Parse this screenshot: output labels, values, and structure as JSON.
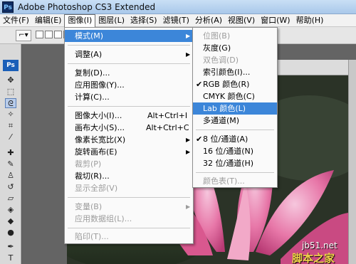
{
  "app": {
    "logo": "Ps",
    "title": "Adobe Photoshop CS3 Extended"
  },
  "menubar": [
    {
      "label": "文件(F)"
    },
    {
      "label": "编辑(E)"
    },
    {
      "label": "图像(I)"
    },
    {
      "label": "图层(L)"
    },
    {
      "label": "选择(S)"
    },
    {
      "label": "滤镜(T)"
    },
    {
      "label": "分析(A)"
    },
    {
      "label": "视图(V)"
    },
    {
      "label": "窗口(W)"
    },
    {
      "label": "帮助(H)"
    }
  ],
  "toolbox": {
    "badge": "Ps"
  },
  "image_menu": {
    "items": [
      {
        "label": "模式(M)",
        "submenu": true,
        "highlighted": true
      },
      {
        "label": "调整(A)",
        "submenu": true
      },
      {
        "label": "复制(D)..."
      },
      {
        "label": "应用图像(Y)..."
      },
      {
        "label": "计算(C)..."
      },
      {
        "label": "图像大小(I)...",
        "shortcut": "Alt+Ctrl+I"
      },
      {
        "label": "画布大小(S)...",
        "shortcut": "Alt+Ctrl+C"
      },
      {
        "label": "像素长宽比(X)",
        "submenu": true
      },
      {
        "label": "旋转画布(E)",
        "submenu": true
      },
      {
        "label": "裁剪(P)",
        "disabled": true
      },
      {
        "label": "裁切(R)..."
      },
      {
        "label": "显示全部(V)",
        "disabled": true
      },
      {
        "label": "变量(B)",
        "submenu": true,
        "disabled": true
      },
      {
        "label": "应用数据组(L)...",
        "disabled": true
      },
      {
        "label": "陷印(T)...",
        "disabled": true
      }
    ]
  },
  "mode_menu": {
    "items": [
      {
        "label": "位图(B)",
        "disabled": true
      },
      {
        "label": "灰度(G)"
      },
      {
        "label": "双色调(D)",
        "disabled": true
      },
      {
        "label": "索引颜色(I)..."
      },
      {
        "label": "RGB 颜色(R)",
        "checked": true
      },
      {
        "label": "CMYK 颜色(C)"
      },
      {
        "label": "Lab 颜色(L)",
        "highlighted": true
      },
      {
        "label": "多通道(M)"
      },
      {
        "label": "8 位/通道(A)",
        "checked": true
      },
      {
        "label": "16 位/通道(N)"
      },
      {
        "label": "32 位/通道(H)"
      },
      {
        "label": "颜色表(T)...",
        "disabled": true
      }
    ]
  },
  "watermark": {
    "site": "jb51.net",
    "name": "脚本之家"
  },
  "colors": {
    "menu_highlight": "#3c86d9",
    "title_bar": "#b9d3f0",
    "disabled_text": "#9c9c9c"
  }
}
